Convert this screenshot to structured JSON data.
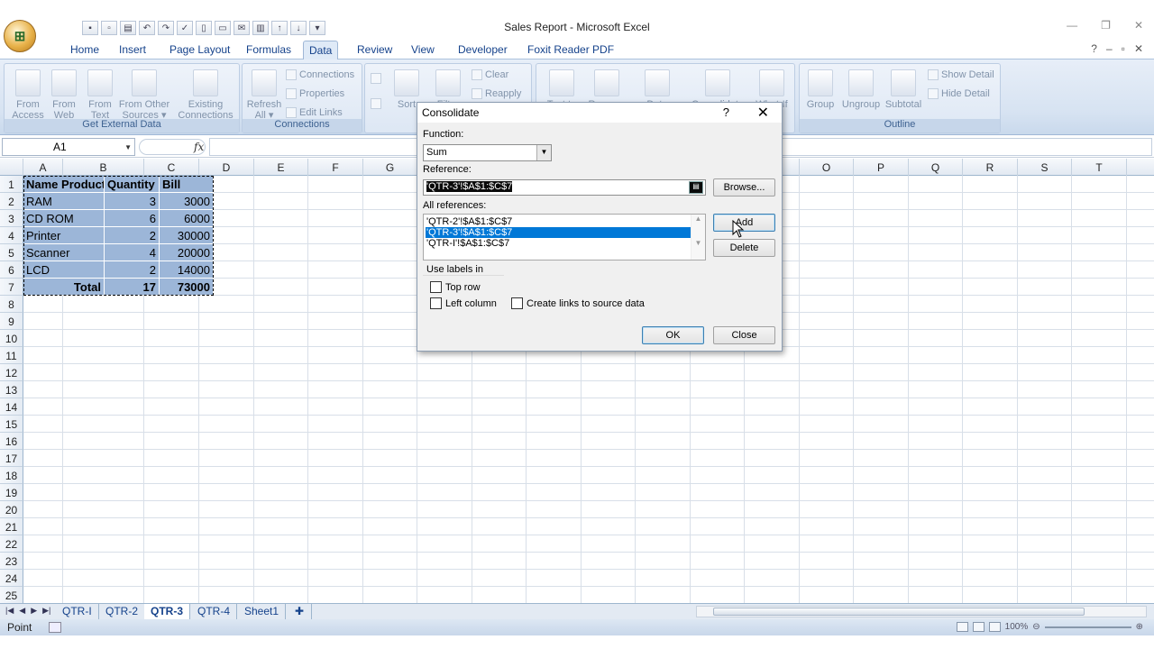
{
  "window": {
    "title": "Sales Report - Microsoft Excel",
    "minimize": "—",
    "restore": "❐",
    "close": "✕",
    "ribbon_minimize": "–",
    "ribbon_restore": "▫",
    "ribbon_close": "✕",
    "help": "?"
  },
  "tabs": [
    "Home",
    "Insert",
    "Page Layout",
    "Formulas",
    "Data",
    "Review",
    "View",
    "Developer",
    "Foxit Reader PDF"
  ],
  "active_tab": "Data",
  "ribbon": {
    "get_external_data": {
      "label": "Get External Data",
      "buttons": [
        [
          "From",
          "Access"
        ],
        [
          "From",
          "Web"
        ],
        [
          "From",
          "Text"
        ],
        [
          "From Other",
          "Sources ▾"
        ],
        [
          "Existing",
          "Connections"
        ]
      ]
    },
    "connections": {
      "label": "Connections",
      "refresh": [
        "Refresh",
        "All ▾"
      ],
      "items": [
        "Connections",
        "Properties",
        "Edit Links"
      ]
    },
    "sort_filter": {
      "sort": "Sort",
      "filter": "Filter",
      "clear": "Clear",
      "reapply": "Reapply"
    },
    "data_tools": {
      "text_to": "Text to",
      "remove": "Remove",
      "data": "Data",
      "consolidate": "Consolidate",
      "whatif": "What-If"
    },
    "outline": {
      "label": "Outline",
      "buttons": [
        "Group",
        "Ungroup",
        "Subtotal"
      ],
      "show_detail": "Show Detail",
      "hide_detail": "Hide Detail"
    }
  },
  "formula_bar": {
    "name_box": "A1",
    "fx": "fx",
    "formula": ""
  },
  "columns": [
    "A",
    "B",
    "C",
    "D",
    "E",
    "F",
    "G",
    "H",
    "I",
    "J",
    "K",
    "L",
    "M",
    "N",
    "O",
    "P",
    "Q",
    "R",
    "S",
    "T"
  ],
  "rows": [
    "1",
    "2",
    "3",
    "4",
    "5",
    "6",
    "7",
    "8",
    "9",
    "10",
    "11",
    "12",
    "13",
    "14",
    "15",
    "16",
    "17",
    "18",
    "19",
    "20",
    "21",
    "22",
    "23",
    "24",
    "25"
  ],
  "table": {
    "headers": [
      "Name Product",
      "Quantity",
      "Bill"
    ],
    "rows": [
      [
        "RAM",
        "3",
        "3000"
      ],
      [
        "CD ROM",
        "6",
        "6000"
      ],
      [
        "Printer",
        "2",
        "30000"
      ],
      [
        "Scanner",
        "4",
        "20000"
      ],
      [
        "LCD",
        "2",
        "14000"
      ]
    ],
    "total": [
      "Total",
      "17",
      "73000"
    ]
  },
  "dialog": {
    "title": "Consolidate",
    "help": "?",
    "close": "✕",
    "function_label": "Function:",
    "function_value": "Sum",
    "reference_label": "Reference:",
    "reference_value": "'QTR-3'!$A$1:$C$7",
    "browse": "Browse...",
    "all_references_label": "All references:",
    "all_references": [
      "'QTR-2'!$A$1:$C$7",
      "'QTR-3'!$A$1:$C$7",
      "'QTR-I'!$A$1:$C$7"
    ],
    "selected_reference_index": 1,
    "add": "Add",
    "delete": "Delete",
    "use_labels_in": "Use labels in",
    "top_row": "Top row",
    "left_column": "Left column",
    "create_links": "Create links to source data",
    "ok": "OK",
    "close_button": "Close"
  },
  "sheets": [
    "QTR-I",
    "QTR-2",
    "QTR-3",
    "QTR-4",
    "Sheet1"
  ],
  "active_sheet": "QTR-3",
  "status": {
    "mode": "Point",
    "zoom": "100%"
  }
}
